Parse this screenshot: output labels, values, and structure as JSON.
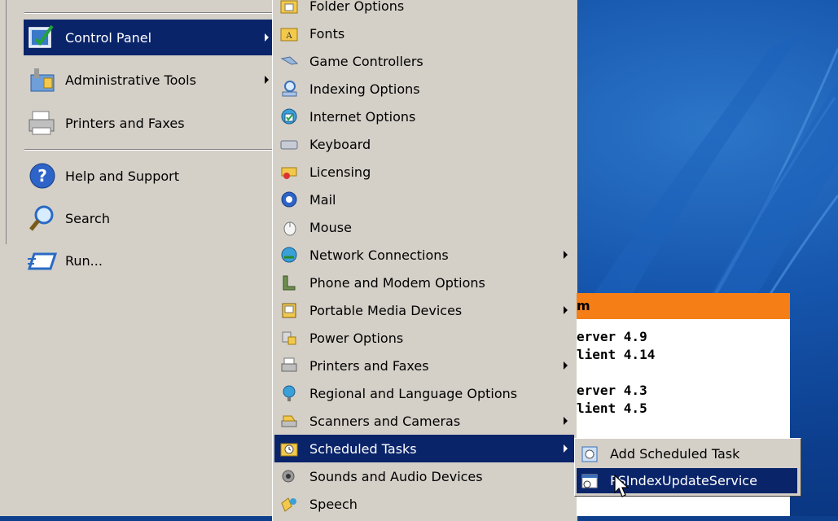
{
  "start_menu": {
    "items": [
      {
        "label": "Control Panel",
        "icon": "control-panel-icon",
        "submenu": true,
        "active": true
      },
      {
        "label": "Administrative Tools",
        "icon": "admin-tools-icon",
        "submenu": true
      },
      {
        "label": "Printers and Faxes",
        "icon": "printer-icon"
      },
      {
        "label": "Help and Support",
        "icon": "help-icon"
      },
      {
        "label": "Search",
        "icon": "search-icon"
      },
      {
        "label": "Run...",
        "icon": "run-icon"
      }
    ]
  },
  "control_panel_menu": {
    "items": [
      {
        "label": "Folder Options",
        "icon": "folder-options-icon"
      },
      {
        "label": "Fonts",
        "icon": "fonts-folder-icon"
      },
      {
        "label": "Game Controllers",
        "icon": "game-controller-icon"
      },
      {
        "label": "Indexing Options",
        "icon": "indexing-icon"
      },
      {
        "label": "Internet Options",
        "icon": "internet-options-icon"
      },
      {
        "label": "Keyboard",
        "icon": "keyboard-icon"
      },
      {
        "label": "Licensing",
        "icon": "licensing-icon"
      },
      {
        "label": "Mail",
        "icon": "mail-icon"
      },
      {
        "label": "Mouse",
        "icon": "mouse-icon"
      },
      {
        "label": "Network Connections",
        "icon": "network-icon",
        "submenu": true
      },
      {
        "label": "Phone and Modem Options",
        "icon": "phone-icon"
      },
      {
        "label": "Portable Media Devices",
        "icon": "portable-media-icon",
        "submenu": true
      },
      {
        "label": "Power Options",
        "icon": "power-icon"
      },
      {
        "label": "Printers and Faxes",
        "icon": "printer-icon",
        "submenu": true
      },
      {
        "label": "Regional and Language Options",
        "icon": "globe-icon"
      },
      {
        "label": "Scanners and Cameras",
        "icon": "scanner-icon",
        "submenu": true
      },
      {
        "label": "Scheduled Tasks",
        "icon": "scheduled-tasks-icon",
        "submenu": true,
        "active": true
      },
      {
        "label": "Sounds and Audio Devices",
        "icon": "speaker-icon"
      },
      {
        "label": "Speech",
        "icon": "speech-icon"
      }
    ]
  },
  "scheduled_tasks_menu": {
    "items": [
      {
        "label": "Add Scheduled Task",
        "icon": "add-task-icon"
      },
      {
        "label": "PSIndexUpdateService",
        "icon": "task-clock-icon",
        "active": true
      }
    ]
  },
  "background_window": {
    "title": "m",
    "lines": [
      "erver 4.9",
      "lient 4.14",
      "erver 4.3",
      "lient 4.5"
    ]
  },
  "colors": {
    "menu_bg": "#d4d0c8",
    "highlight": "#0a246a",
    "accent_orange": "#f57f16",
    "desktop_blue": "#0d3f8c"
  }
}
